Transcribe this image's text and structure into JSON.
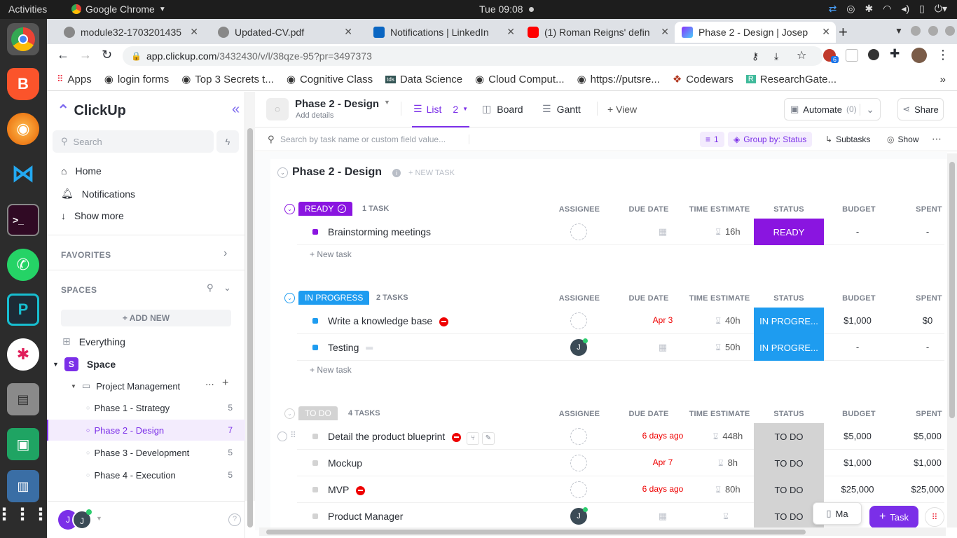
{
  "os": {
    "activities": "Activities",
    "app_name": "Google Chrome",
    "clock": "Tue 09:08"
  },
  "browser": {
    "tabs": [
      {
        "label": "module32-1703201435"
      },
      {
        "label": "Updated-CV.pdf"
      },
      {
        "label": "Notifications | LinkedIn"
      },
      {
        "label": "(1) Roman Reigns' defin"
      },
      {
        "label": "Phase 2 - Design | Josep"
      }
    ],
    "url_host": "app.clickup.com",
    "url_path": "/3432430/v/l/38qze-95?pr=3497373",
    "bookmarks": [
      {
        "label": "Apps"
      },
      {
        "label": "login forms"
      },
      {
        "label": "Top 3 Secrets t..."
      },
      {
        "label": "Cognitive Class"
      },
      {
        "label": "Data Science"
      },
      {
        "label": "Cloud Comput..."
      },
      {
        "label": "https://putsre..."
      },
      {
        "label": "Codewars"
      },
      {
        "label": "ResearchGate..."
      }
    ],
    "extension_badge": "6"
  },
  "sidebar": {
    "logo": "ClickUp",
    "search_placeholder": "Search",
    "nav": [
      {
        "label": "Home"
      },
      {
        "label": "Notifications"
      },
      {
        "label": "Show more"
      }
    ],
    "favorites_label": "FAVORITES",
    "spaces_label": "SPACES",
    "add_new": "+ ADD NEW",
    "everything": "Everything",
    "space_letter": "S",
    "space_name": "Space",
    "folder_name": "Project Management",
    "lists": [
      {
        "label": "Phase 1 - Strategy",
        "count": "5"
      },
      {
        "label": "Phase 2 - Design",
        "count": "7"
      },
      {
        "label": "Phase 3 - Development",
        "count": "5"
      },
      {
        "label": "Phase 4 - Execution",
        "count": "5"
      }
    ],
    "user_initial": "J",
    "user_initial2": "J"
  },
  "header": {
    "title": "Phase 2 - Design",
    "subtitle": "Add details",
    "views": [
      {
        "label": "List",
        "count": "2"
      },
      {
        "label": "Board"
      },
      {
        "label": "Gantt"
      }
    ],
    "add_view": "+ View",
    "automate": "Automate",
    "automate_count": "(0)",
    "share": "Share"
  },
  "filterbar": {
    "search_placeholder": "Search by task name or custom field value...",
    "filter_count": "1",
    "group_by": "Group by: Status",
    "subtasks": "Subtasks",
    "show": "Show"
  },
  "list": {
    "title": "Phase 2 - Design",
    "new_task_btn": "+ NEW TASK",
    "columns": [
      "ASSIGNEE",
      "DUE DATE",
      "TIME ESTIMATE",
      "STATUS",
      "BUDGET",
      "SPENT"
    ],
    "new_task_link": "+ New task",
    "groups": [
      {
        "label": "READY",
        "count_label": "1 TASK",
        "color": "#8a15e0",
        "tasks": [
          {
            "name": "Brainstorming meetings",
            "due": "",
            "estimate": "16h",
            "status": "READY",
            "budget": "-",
            "spent": "-"
          }
        ]
      },
      {
        "label": "IN PROGRESS",
        "count_label": "2 TASKS",
        "color": "#1e9cf0",
        "tasks": [
          {
            "name": "Write a knowledge base",
            "due": "Apr 3",
            "estimate": "40h",
            "status": "IN PROGRE...",
            "budget": "$1,000",
            "spent": "$0"
          },
          {
            "name": "Testing",
            "due": "",
            "estimate": "50h",
            "status": "IN PROGRE...",
            "budget": "-",
            "spent": "-",
            "assignee": "J"
          }
        ]
      },
      {
        "label": "TO DO",
        "count_label": "4 TASKS",
        "color": "#d3d3d3",
        "tasks": [
          {
            "name": "Detail the product blueprint",
            "due": "6 days ago",
            "estimate": "448h",
            "status": "TO DO",
            "budget": "$5,000",
            "spent": "$5,000"
          },
          {
            "name": "Mockup",
            "due": "Apr 7",
            "estimate": "8h",
            "status": "TO DO",
            "budget": "$1,000",
            "spent": "$1,000"
          },
          {
            "name": "MVP",
            "due": "6 days ago",
            "estimate": "80h",
            "status": "TO DO",
            "budget": "$25,000",
            "spent": "$25,000"
          },
          {
            "name": "Product Manager",
            "due": "",
            "estimate": "",
            "status": "TO DO",
            "budget": "",
            "spent": "",
            "assignee": "J"
          }
        ]
      }
    ]
  },
  "floating": {
    "ma_label": "Ma",
    "task_button": "Task"
  }
}
